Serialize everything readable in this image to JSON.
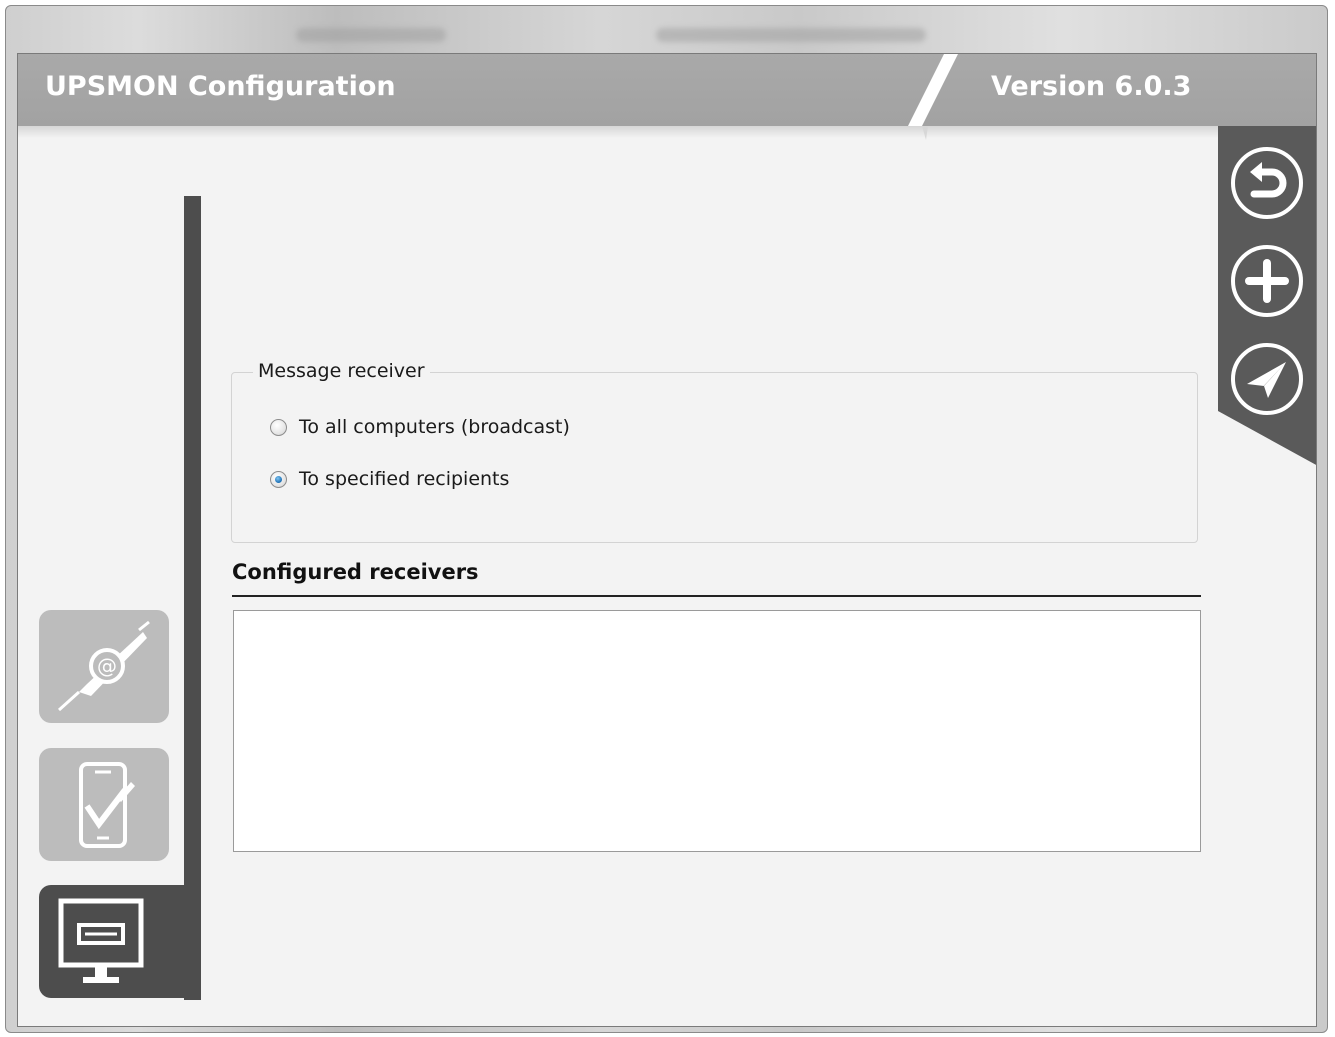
{
  "window": {
    "title": "UPSMON Configuration",
    "version": "Version 6.0.3"
  },
  "toolbar": {
    "actions": [
      {
        "name": "back",
        "icon": "undo-arrow-icon"
      },
      {
        "name": "add",
        "icon": "plus-icon"
      },
      {
        "name": "send",
        "icon": "paper-plane-icon"
      }
    ]
  },
  "sidebar": {
    "items": [
      {
        "name": "email",
        "icon": "email-pen-icon",
        "active": false
      },
      {
        "name": "sms",
        "icon": "mobile-check-icon",
        "active": false
      },
      {
        "name": "network-message",
        "icon": "monitor-icon",
        "active": true
      }
    ]
  },
  "message_receiver": {
    "legend": "Message receiver",
    "options": [
      {
        "label": "To all computers (broadcast)",
        "checked": false
      },
      {
        "label": "To specified recipients",
        "checked": true
      }
    ]
  },
  "configured_receivers": {
    "title": "Configured receivers",
    "items": []
  },
  "colors": {
    "header": "#a6a6a6",
    "sidebar_dark": "#4d4d4d",
    "tile_inactive": "#bcbcbc",
    "radio_selected": "#1c6fb5"
  }
}
